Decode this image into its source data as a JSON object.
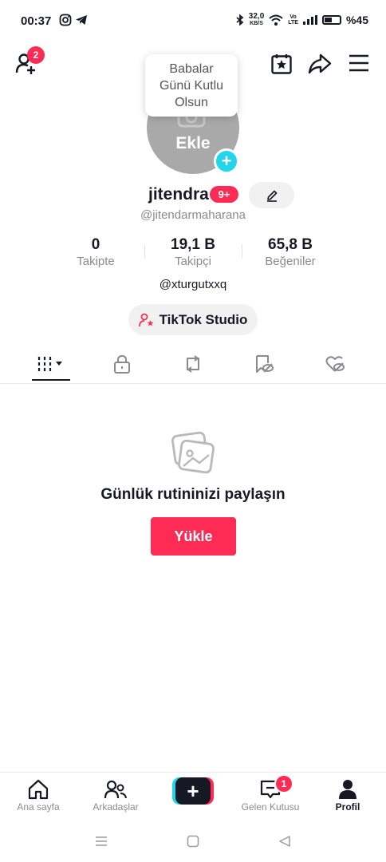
{
  "status_bar": {
    "time": "00:37",
    "net_speed_value": "32,0",
    "net_speed_unit": "KB/S",
    "volte_top": "Vo",
    "volte_bottom": "LTE",
    "battery": "%45"
  },
  "header": {
    "add_friends_badge": "2",
    "tooltip_lines": [
      "Babalar",
      "Günü Kutlu",
      "Olsun"
    ]
  },
  "profile": {
    "avatar_label": "Ekle",
    "add_icon": "+",
    "username": "jitendra",
    "level_badge": "9+",
    "handle": "@jitendarmaharana",
    "stats": [
      {
        "value": "0",
        "label": "Takipte"
      },
      {
        "value": "19,1 B",
        "label": "Takipçi"
      },
      {
        "value": "65,8 B",
        "label": "Beğeniler"
      }
    ],
    "bio": "@xturgutxxq",
    "studio_button": "TikTok Studio"
  },
  "tabs": [
    {
      "icon": "grid-icon",
      "active": true
    },
    {
      "icon": "lock-icon"
    },
    {
      "icon": "repost-icon"
    },
    {
      "icon": "favorites-icon"
    },
    {
      "icon": "liked-icon"
    }
  ],
  "empty_state": {
    "icon": "photos-icon",
    "title": "Günlük rutininizi paylaşın",
    "button": "Yükle"
  },
  "bottom_nav": {
    "home": "Ana sayfa",
    "friends": "Arkadaşlar",
    "create": "+",
    "inbox": "Gelen Kutusu",
    "inbox_badge": "1",
    "profile": "Profil"
  },
  "colors": {
    "accent": "#fe2c55",
    "cyan": "#20d5ec",
    "text": "#161823",
    "muted": "#8a8b91"
  }
}
